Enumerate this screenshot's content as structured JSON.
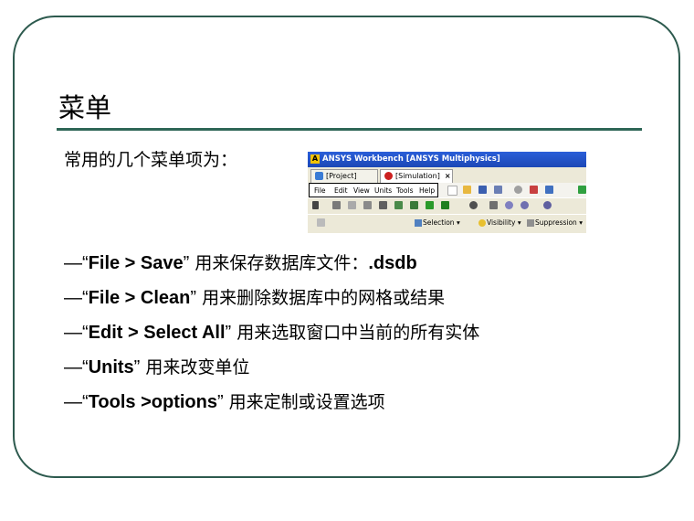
{
  "slide": {
    "title": "菜单",
    "intro": "常用的几个菜单项为：",
    "screenshot": {
      "window_title": "ANSYS Workbench [ANSYS Multiphysics]",
      "tabs": [
        {
          "label": "[Project]"
        },
        {
          "label": "[Simulation]",
          "close": "×"
        }
      ],
      "menu": [
        "File",
        "Edit",
        "View",
        "Units",
        "Tools",
        "Help"
      ],
      "toolbar2": [
        {
          "label": "Selection",
          "arrow": "▾"
        },
        {
          "label": "Visibility",
          "arrow": "▾"
        },
        {
          "label": "Suppression",
          "arrow": "▾"
        }
      ]
    },
    "bullets": [
      {
        "dash": "—",
        "open": "“",
        "cmd": "File > Save",
        "close": "”",
        "desc": " 用来保存数据库文件：",
        "ext": ".dsdb"
      },
      {
        "dash": "—",
        "open": "“",
        "cmd": "File > Clean",
        "close": "”",
        "desc": " 用来删除数据库中的网格或结果",
        "ext": ""
      },
      {
        "dash": "—",
        "open": "“",
        "cmd": "Edit > Select All",
        "close": "”",
        "desc": " 用来选取窗口中当前的所有实体",
        "ext": ""
      },
      {
        "dash": "—",
        "open": "“",
        "cmd": "Units",
        "close": "”",
        "desc": " 用来改变单位",
        "ext": ""
      },
      {
        "dash": "—",
        "open": "“",
        "cmd": "Tools >options",
        "close": "”",
        "desc": " 用来定制或设置选项",
        "ext": ""
      }
    ]
  },
  "colors": {
    "border": "#2d5a4e",
    "rule": "#2e6656",
    "titlebar": "#1c48b6"
  }
}
